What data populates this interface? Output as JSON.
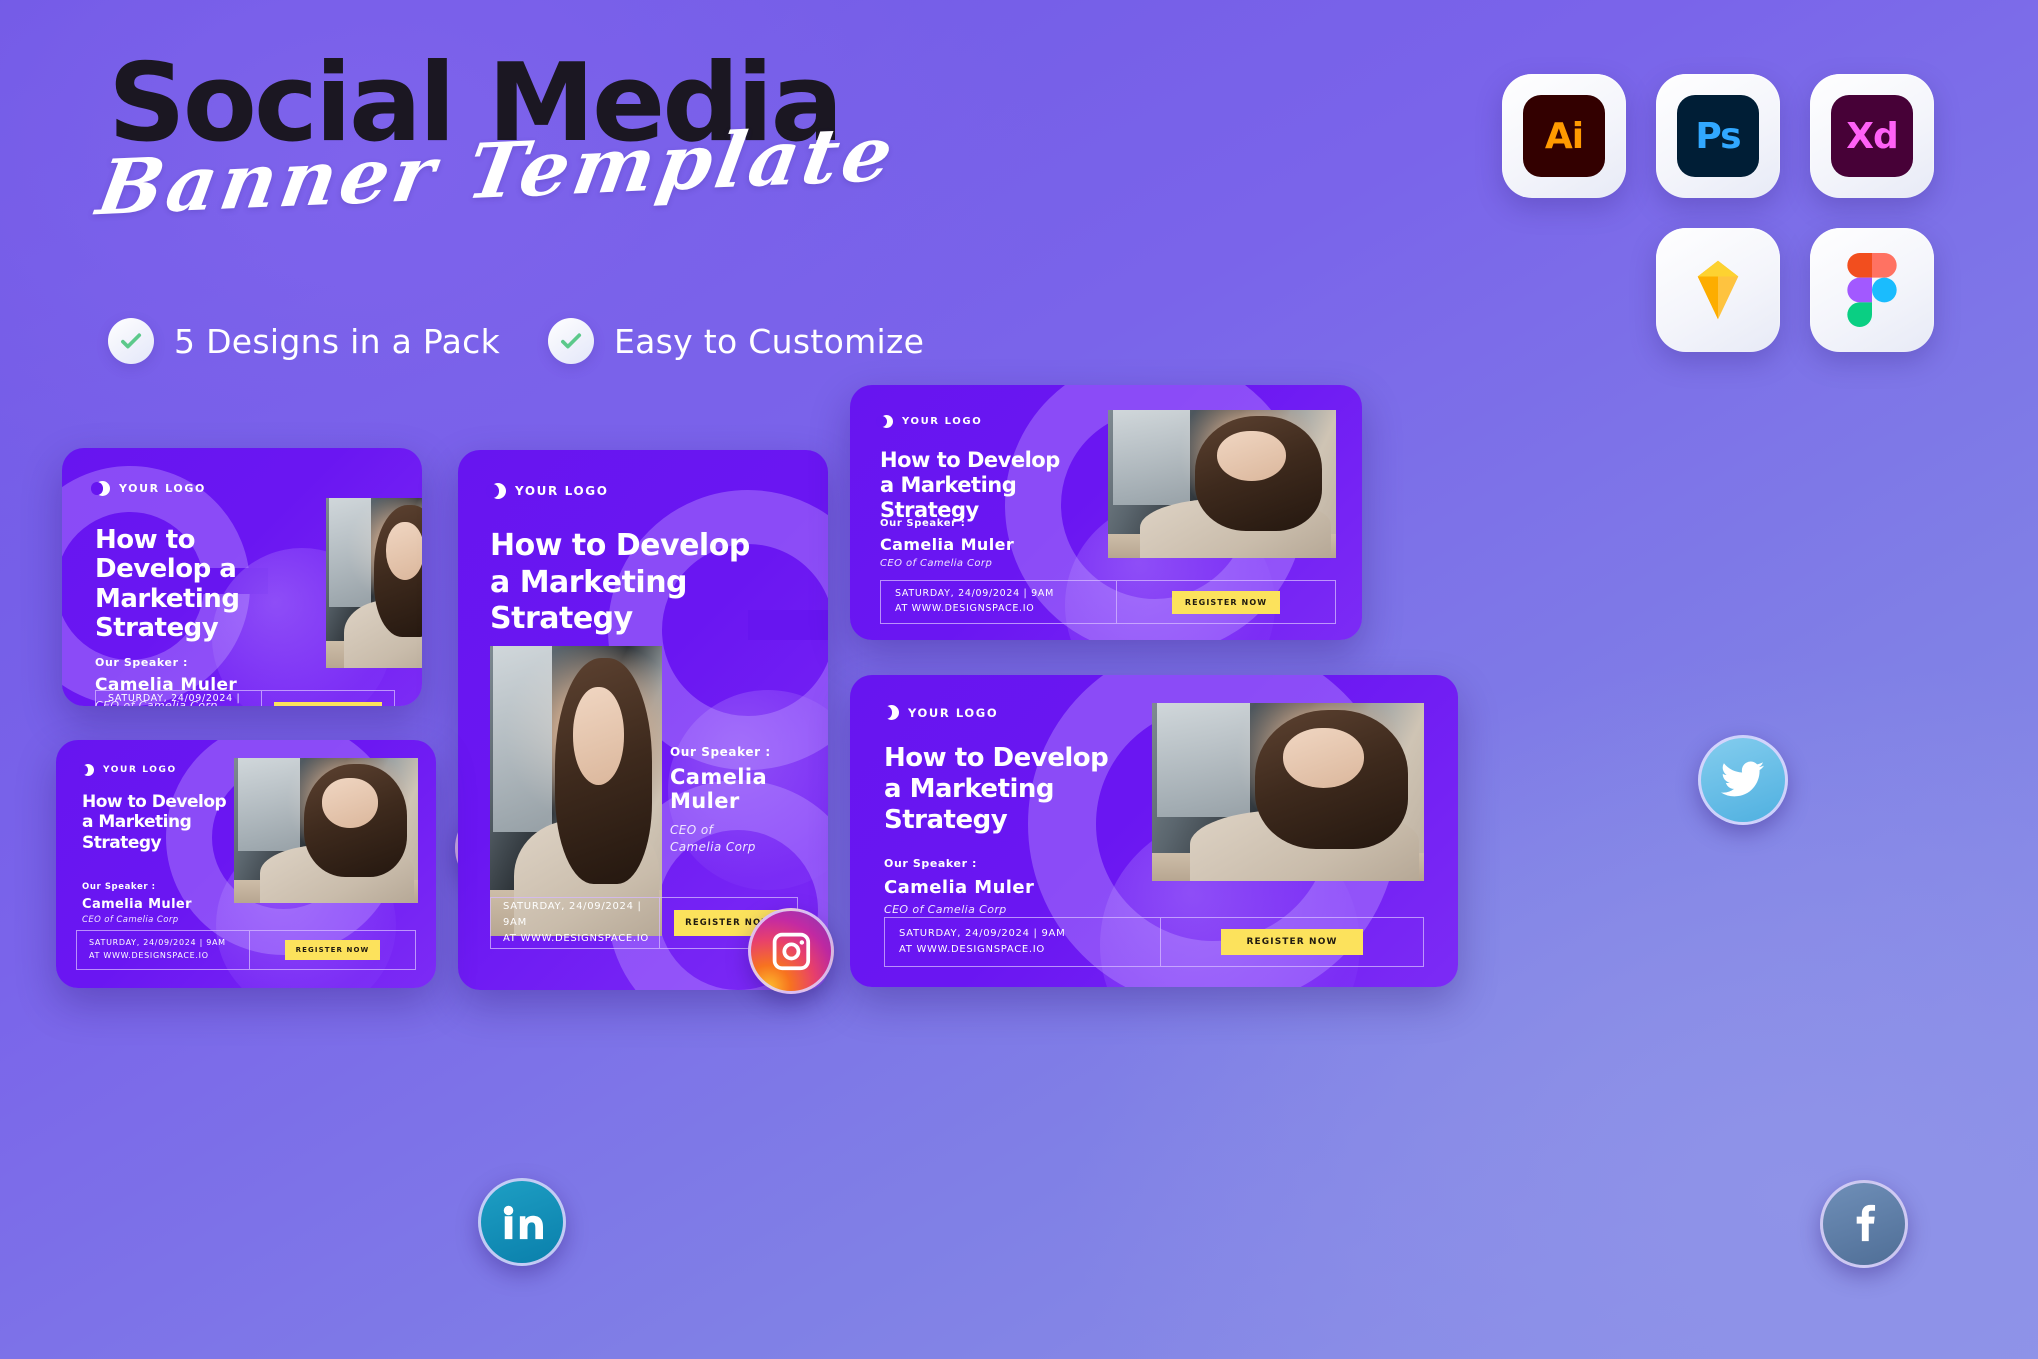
{
  "hero": {
    "title_bold": "Social Media",
    "title_script": "Banner Template",
    "features": [
      {
        "label": "5 Designs in a Pack",
        "icon": "check-icon"
      },
      {
        "label": "Easy to Customize",
        "icon": "check-icon"
      }
    ]
  },
  "apps": [
    {
      "name": "illustrator",
      "label": "Ai",
      "bg": "#330000",
      "fg": "#FF9A00"
    },
    {
      "name": "photoshop",
      "label": "Ps",
      "bg": "#001E36",
      "fg": "#31A8FF"
    },
    {
      "name": "xd",
      "label": "Xd",
      "bg": "#470137",
      "fg": "#FF61F6"
    },
    {
      "name": "sketch",
      "label": "",
      "bg": "",
      "fg": "#FDB300"
    },
    {
      "name": "figma",
      "label": "",
      "bg": "",
      "fg": ""
    }
  ],
  "banner_common": {
    "logo_text": "YOUR LOGO",
    "heading": "How to Develop a Marketing Strategy",
    "speaker_label": "Our Speaker :",
    "speaker_name": "Camelia Muler",
    "speaker_role": "CEO of Camelia Corp",
    "date_line": "SATURDAY, 24/09/2024 | 9AM",
    "url_line": "AT WWW.DESIGNSPACE.IO",
    "cta": "REGISTER NOW"
  },
  "banners": [
    {
      "id": "banner-portrait-left",
      "heading_lines": [
        "How to",
        "Develop a",
        "Marketing",
        "Strategy"
      ],
      "speaker_name_lines": [
        "Camelia Muler"
      ],
      "role_lines": [
        "CEO of Camelia Corp"
      ],
      "social": "instagram"
    },
    {
      "id": "banner-story-center",
      "heading_lines": [
        "How to Develop",
        "a Marketing",
        "Strategy"
      ],
      "speaker_name_lines": [
        "Camelia",
        "Muler"
      ],
      "role_lines": [
        "CEO of",
        "Camelia Corp"
      ],
      "social": "instagram"
    },
    {
      "id": "banner-wide-top-right",
      "heading_lines": [
        "How to Develop",
        "a Marketing",
        "Strategy"
      ],
      "speaker_name_lines": [
        "Camelia Muler"
      ],
      "role_lines": [
        "CEO of Camelia Corp"
      ],
      "social": "twitter"
    },
    {
      "id": "banner-wide-bottom-left",
      "heading_lines": [
        "How to Develop",
        "a Marketing",
        "Strategy"
      ],
      "speaker_name_lines": [
        "Camelia Muler"
      ],
      "role_lines": [
        "CEO of Camelia Corp"
      ],
      "social": "linkedin"
    },
    {
      "id": "banner-wide-bottom-right",
      "heading_lines": [
        "How to Develop",
        "a Marketing",
        "Strategy"
      ],
      "speaker_name_lines": [
        "Camelia Muler"
      ],
      "role_lines": [
        "CEO of Camelia Corp"
      ],
      "social": "facebook"
    }
  ],
  "colors": {
    "background_start": "#6f57e4",
    "background_end": "#8e93e7",
    "card_purple": "#6715f0",
    "cta_yellow": "#FCE25C",
    "heading_dark": "#1b1722",
    "check_green": "#5CC98B"
  }
}
